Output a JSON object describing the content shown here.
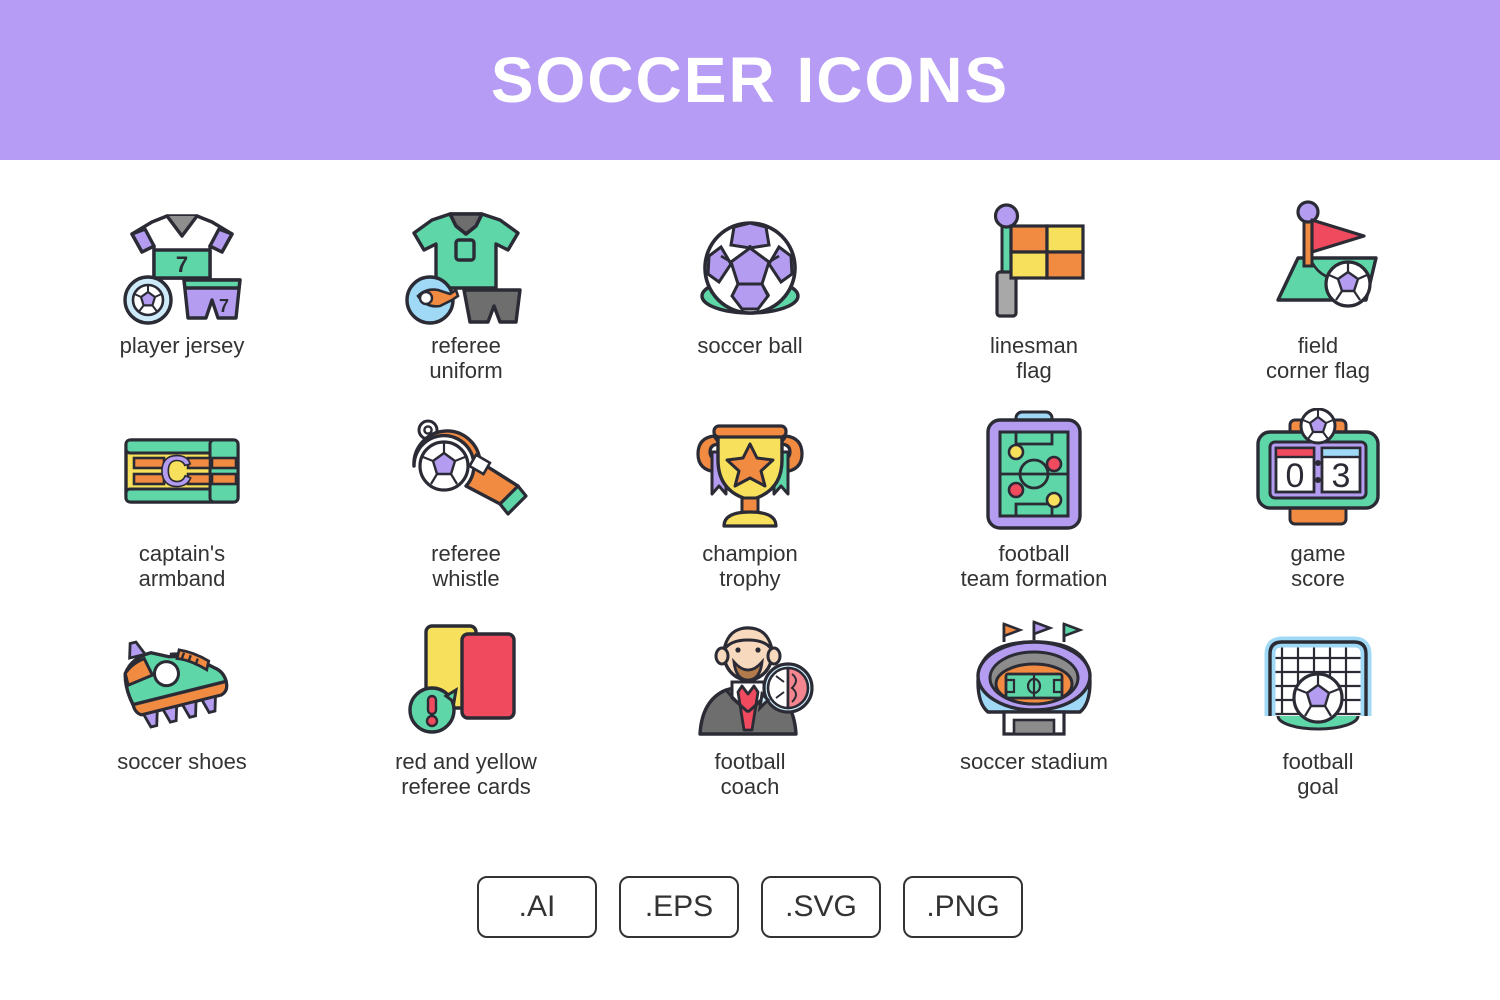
{
  "header": {
    "title": "SOCCER ICONS",
    "background_color": "#b69cf5",
    "title_color": "#ffffff"
  },
  "palette": {
    "outline": "#2b2b35",
    "purple": "#b49cf0",
    "green": "#5ed6a8",
    "orange": "#f28b42",
    "yellow": "#f7e05c",
    "red": "#f04a5e",
    "light_blue": "#9fd9f6",
    "gray": "#6e6e6e",
    "white": "#ffffff",
    "label": "#333333"
  },
  "icons": [
    {
      "name": "player-jersey",
      "label": "player jersey",
      "number": "7"
    },
    {
      "name": "referee-uniform",
      "label": "referee\nuniform"
    },
    {
      "name": "soccer-ball",
      "label": "soccer ball"
    },
    {
      "name": "linesman-flag",
      "label": "linesman\nflag"
    },
    {
      "name": "field-corner-flag",
      "label": "field\ncorner flag"
    },
    {
      "name": "captains-armband",
      "label": "captain's\narmband",
      "letter": "C"
    },
    {
      "name": "referee-whistle",
      "label": "referee\nwhistle"
    },
    {
      "name": "champion-trophy",
      "label": "champion\ntrophy"
    },
    {
      "name": "football-team-formation",
      "label": "football\nteam formation"
    },
    {
      "name": "game-score",
      "label": "game\nscore",
      "score_home": "0",
      "score_away": "3"
    },
    {
      "name": "soccer-shoes",
      "label": "soccer shoes"
    },
    {
      "name": "red-and-yellow-referee-cards",
      "label": "red and yellow\nreferee cards"
    },
    {
      "name": "football-coach",
      "label": "football\ncoach"
    },
    {
      "name": "soccer-stadium",
      "label": "soccer stadium"
    },
    {
      "name": "football-goal",
      "label": "football\ngoal"
    }
  ],
  "formats": [
    {
      "label": ".AI"
    },
    {
      "label": ".EPS"
    },
    {
      "label": ".SVG"
    },
    {
      "label": ".PNG"
    }
  ]
}
